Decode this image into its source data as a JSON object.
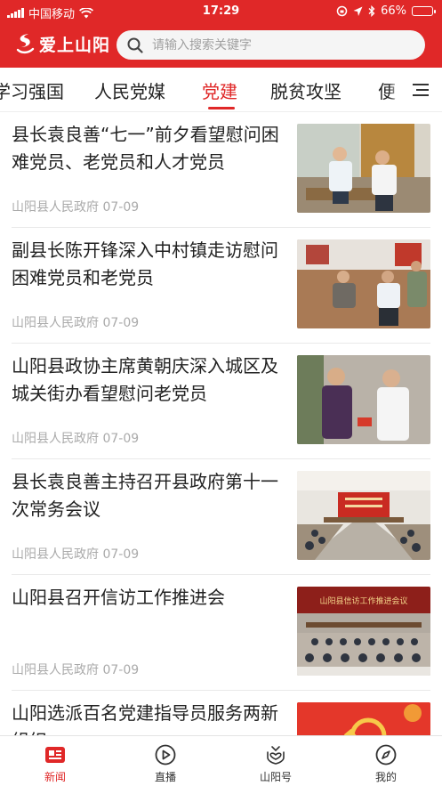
{
  "status_bar": {
    "carrier": "中国移动",
    "time": "17:29",
    "battery": "66%",
    "battery_level": 0.66
  },
  "header": {
    "app_name": "爱上山阳",
    "search_placeholder": "请输入搜索关键字"
  },
  "tabs": [
    {
      "label": "学习强国",
      "active": false
    },
    {
      "label": "人民党媒",
      "active": false
    },
    {
      "label": "党建",
      "active": true
    },
    {
      "label": "脱贫攻坚",
      "active": false
    },
    {
      "label": "便",
      "active": false
    }
  ],
  "news": [
    {
      "title": "县长袁良善“七一”前夕看望慰问困难党员、老党员和人才党员",
      "source": "山阳县人民政府",
      "date": "07-09",
      "image": "visit-photo"
    },
    {
      "title": "副县长陈开锋深入中村镇走访慰问困难党员和老党员",
      "source": "山阳县人民政府",
      "date": "07-09",
      "image": "home-visit-photo"
    },
    {
      "title": "山阳县政协主席黄朝庆深入城区及城关街办看望慰问老党员",
      "source": "山阳县人民政府",
      "date": "07-09",
      "image": "handshake-photo"
    },
    {
      "title": "县长袁良善主持召开县政府第十一次常务会议",
      "source": "山阳县人民政府",
      "date": "07-09",
      "image": "meeting-photo"
    },
    {
      "title": "山阳县召开信访工作推进会",
      "source": "山阳县人民政府",
      "date": "07-09",
      "image": "conference-photo",
      "image_banner": "山阳县信访工作推进会议"
    },
    {
      "title": "山阳选派百名党建指导员服务两新组织",
      "source": "",
      "date": "",
      "image": "party-emblem-photo"
    }
  ],
  "bottom_nav": [
    {
      "label": "新闻",
      "icon": "news-icon",
      "active": true
    },
    {
      "label": "直播",
      "icon": "play-icon",
      "active": false
    },
    {
      "label": "山阳号",
      "icon": "heart-hands-icon",
      "active": false
    },
    {
      "label": "我的",
      "icon": "compass-icon",
      "active": false
    }
  ],
  "colors": {
    "brand_red": "#e02828",
    "meta_gray": "#aaaaaa"
  }
}
